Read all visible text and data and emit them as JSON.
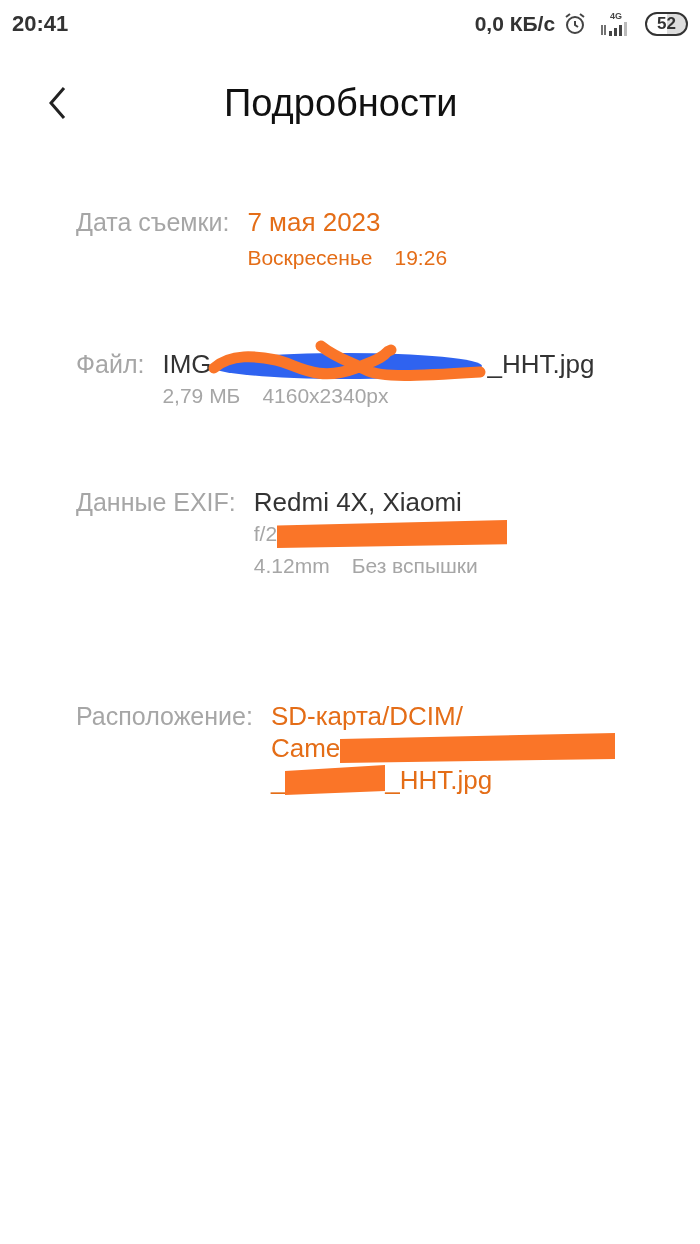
{
  "status_bar": {
    "time": "20:41",
    "speed": "0,0 КБ/с",
    "network": "4G",
    "battery": "52"
  },
  "header": {
    "title": "Подробности"
  },
  "details": [
    {
      "label": "Дата съемки:",
      "accent": true,
      "lines": [
        {
          "kind": "primary",
          "segments": [
            {
              "kind": "text",
              "text": "7 мая 2023"
            }
          ]
        },
        {
          "kind": "secondary",
          "segments": [
            {
              "kind": "text",
              "text": "Воскресенье"
            },
            {
              "kind": "text",
              "text": "19:26"
            }
          ]
        }
      ]
    },
    {
      "label": "Файл:",
      "accent": false,
      "lines": [
        {
          "kind": "primary",
          "segments": [
            {
              "kind": "text",
              "text": "IMG"
            },
            {
              "kind": "scribble"
            },
            {
              "kind": "text",
              "text": "_HHT.jpg"
            }
          ]
        },
        {
          "kind": "secondary",
          "segments": [
            {
              "kind": "text",
              "text": "2,79 МБ"
            },
            {
              "kind": "text",
              "text": "4160x2340px"
            }
          ]
        }
      ]
    },
    {
      "label": "Данные EXIF:",
      "accent": false,
      "lines": [
        {
          "kind": "primary",
          "segments": [
            {
              "kind": "text",
              "text": "Redmi 4X, Xiaomi"
            }
          ]
        },
        {
          "kind": "secondary",
          "segments": [
            {
              "kind": "text",
              "text": "f/2"
            },
            {
              "kind": "redaction"
            }
          ]
        },
        {
          "kind": "secondary",
          "segments": [
            {
              "kind": "text",
              "text": "4.12mm"
            },
            {
              "kind": "text",
              "text": "Без вспышки"
            }
          ]
        }
      ]
    },
    {
      "label": "Расположение:",
      "accent": true,
      "lines": [
        {
          "kind": "primary",
          "segments": [
            {
              "kind": "text",
              "text": "SD-карта/DCIM/"
            }
          ]
        },
        {
          "kind": "primary",
          "segments": [
            {
              "kind": "text",
              "text": "Came"
            },
            {
              "kind": "redaction"
            }
          ]
        },
        {
          "kind": "primary",
          "segments": [
            {
              "kind": "text",
              "text": "_"
            },
            {
              "kind": "redaction"
            },
            {
              "kind": "text",
              "text": "_HHT.jpg"
            }
          ]
        }
      ]
    }
  ]
}
